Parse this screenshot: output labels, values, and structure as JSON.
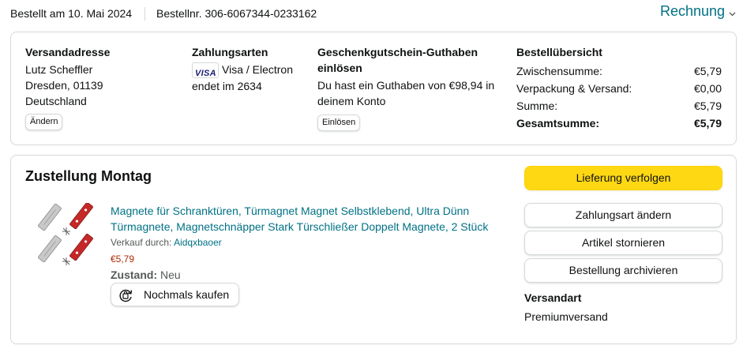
{
  "header": {
    "order_date": "Bestellt am 10. Mai 2024",
    "order_number": "Bestellnr. 306-6067344-0233162",
    "invoice_label": "Rechnung"
  },
  "shipping_address": {
    "heading": "Versandadresse",
    "name": "Lutz Scheffler",
    "city": "Dresden, 01139",
    "country": "Deutschland",
    "change_button": "Ändern"
  },
  "payment": {
    "heading": "Zahlungsarten",
    "card_brand": "VISA",
    "card_type": "Visa / Electron",
    "card_ending": "endet im 2634"
  },
  "gift_card": {
    "heading_line1": "Geschenkgutschein-Guthaben",
    "heading_line2": "einlösen",
    "text_line1": "Du hast ein Guthaben von €98,94 in",
    "text_line2": "deinem Konto",
    "redeem_button": "Einlösen"
  },
  "summary": {
    "heading": "Bestellübersicht",
    "rows": [
      {
        "label": "Zwischensumme:",
        "value": "€5,79"
      },
      {
        "label": "Verpackung & Versand:",
        "value": "€0,00"
      },
      {
        "label": "Summe:",
        "value": "€5,79"
      },
      {
        "label": "Gesamtsumme:",
        "value": "€5,79"
      }
    ]
  },
  "delivery": {
    "title": "Zustellung Montag",
    "product": {
      "title_line1": "Magnete für Schranktüren, Türmagnet Magnet Selbstklebend, Ultra Dünn",
      "title_line2": "Türmagnete, Magnetschnäpper Stark Türschließer Doppelt Magnete, 2 Stück",
      "seller_label": "Verkauf durch:",
      "seller_name": "Aidqxbaoer",
      "price": "€5,79",
      "condition_label": "Zustand:",
      "condition_value": "Neu",
      "buy_again": "Nochmals kaufen"
    },
    "actions": {
      "track": "Lieferung verfolgen",
      "change_payment": "Zahlungsart ändern",
      "cancel": "Artikel stornieren",
      "archive": "Bestellung archivieren"
    },
    "shipping_method_label": "Versandart",
    "shipping_method_value": "Premiumversand"
  },
  "colors": {
    "link": "#007185",
    "price": "#b12704",
    "primary_button": "#ffd814",
    "border": "#d5d9d9"
  },
  "icons": [
    "chevron-down-icon",
    "visa-card-icon",
    "buy-again-icon"
  ]
}
